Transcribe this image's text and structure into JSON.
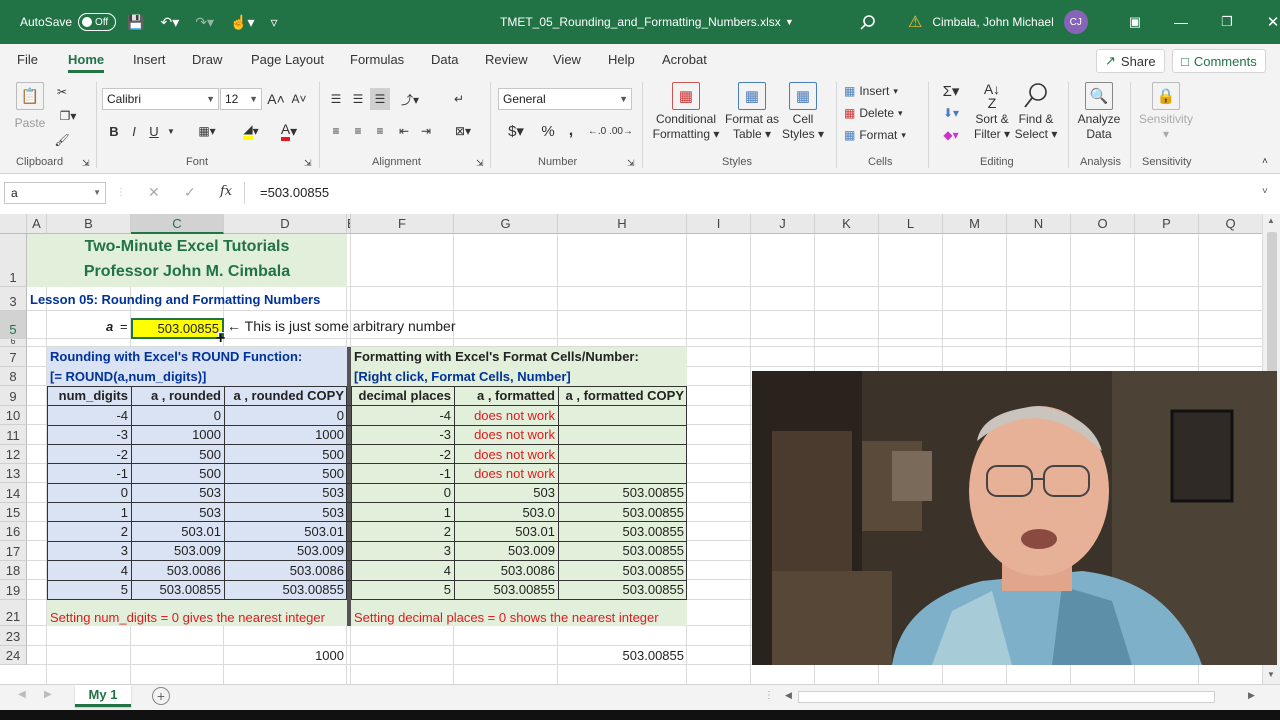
{
  "titlebar": {
    "autosave": "AutoSave",
    "toggle": "Off",
    "filename": "TMET_05_Rounding_and_Formatting_Numbers.xlsx",
    "user": "Cimbala, John Michael",
    "initials": "CJ"
  },
  "menu": {
    "tabs": [
      "File",
      "Home",
      "Insert",
      "Draw",
      "Page Layout",
      "Formulas",
      "Data",
      "Review",
      "View",
      "Help",
      "Acrobat"
    ],
    "share": "Share",
    "comments": "Comments"
  },
  "ribbon": {
    "paste": "Paste",
    "clipboard": "Clipboard",
    "font_name": "Calibri",
    "font_size": "12",
    "font": "Font",
    "alignment": "Alignment",
    "number_format": "General",
    "number": "Number",
    "cond_fmt": [
      "Conditional",
      "Formatting"
    ],
    "format_table": [
      "Format as",
      "Table"
    ],
    "cell_styles": [
      "Cell",
      "Styles"
    ],
    "styles": "Styles",
    "insert": "Insert",
    "delete": "Delete",
    "format": "Format",
    "cells": "Cells",
    "sort": [
      "Sort &",
      "Filter"
    ],
    "find": [
      "Find &",
      "Select"
    ],
    "editing": "Editing",
    "analyze": [
      "Analyze",
      "Data"
    ],
    "analysis": "Analysis",
    "sensitivity": "Sensitivity",
    "sensitivity_group": "Sensitivity",
    "bold": "B",
    "italic": "I",
    "underline": "U",
    "font_color": "A",
    "currency": "$",
    "percent": "%",
    "comma": ","
  },
  "formula_bar": {
    "name_box": "a",
    "formula": "=503.00855",
    "fx": "fx"
  },
  "columns": [
    "A",
    "B",
    "C",
    "D",
    "E",
    "F",
    "G",
    "H",
    "I",
    "J",
    "K",
    "L",
    "M",
    "N",
    "O",
    "P",
    "Q"
  ],
  "rows": [
    "1",
    "3",
    "5",
    "6",
    "7",
    "8",
    "9",
    "10",
    "11",
    "12",
    "13",
    "14",
    "15",
    "16",
    "17",
    "18",
    "19",
    "21",
    "23",
    "24"
  ],
  "sheet": {
    "title1": "Two-Minute Excel Tutorials",
    "title2": "Professor John M. Cimbala",
    "lesson": "Lesson 05: Rounding and Formatting Numbers",
    "a_label": "a",
    "equals": "=",
    "a_value": "503.00855",
    "arrow_note": "← This is just some arbitrary number",
    "round_head1": "Rounding with Excel's ROUND Function:",
    "round_head2": "[= ROUND(a,num_digits)]",
    "fmt_head1": "Formatting with Excel's Format Cells/Number:",
    "fmt_head2": "[Right click, Format Cells, Number]",
    "col_headers": [
      "num_digits",
      "a , rounded",
      "a , rounded COPY",
      "decimal places",
      "a , formatted",
      "a , formatted COPY"
    ],
    "data_rows": [
      [
        "-4",
        "0",
        "0",
        "-4",
        "does not work",
        ""
      ],
      [
        "-3",
        "1000",
        "1000",
        "-3",
        "does not work",
        ""
      ],
      [
        "-2",
        "500",
        "500",
        "-2",
        "does not work",
        ""
      ],
      [
        "-1",
        "500",
        "500",
        "-1",
        "does not work",
        ""
      ],
      [
        "0",
        "503",
        "503",
        "0",
        "503",
        "503.00855"
      ],
      [
        "1",
        "503",
        "503",
        "1",
        "503.0",
        "503.00855"
      ],
      [
        "2",
        "503.01",
        "503.01",
        "2",
        "503.01",
        "503.00855"
      ],
      [
        "3",
        "503.009",
        "503.009",
        "3",
        "503.009",
        "503.00855"
      ],
      [
        "4",
        "503.0086",
        "503.0086",
        "4",
        "503.0086",
        "503.00855"
      ],
      [
        "5",
        "503.00855",
        "503.00855",
        "5",
        "503.00855",
        "503.00855"
      ]
    ],
    "note_round": "Setting num_digits = 0 gives the nearest integer",
    "note_fmt": "Setting decimal places = 0 shows the nearest integer",
    "row23_d": "1000",
    "row23_h": "503.00855"
  },
  "sheet_tab": "My 1"
}
